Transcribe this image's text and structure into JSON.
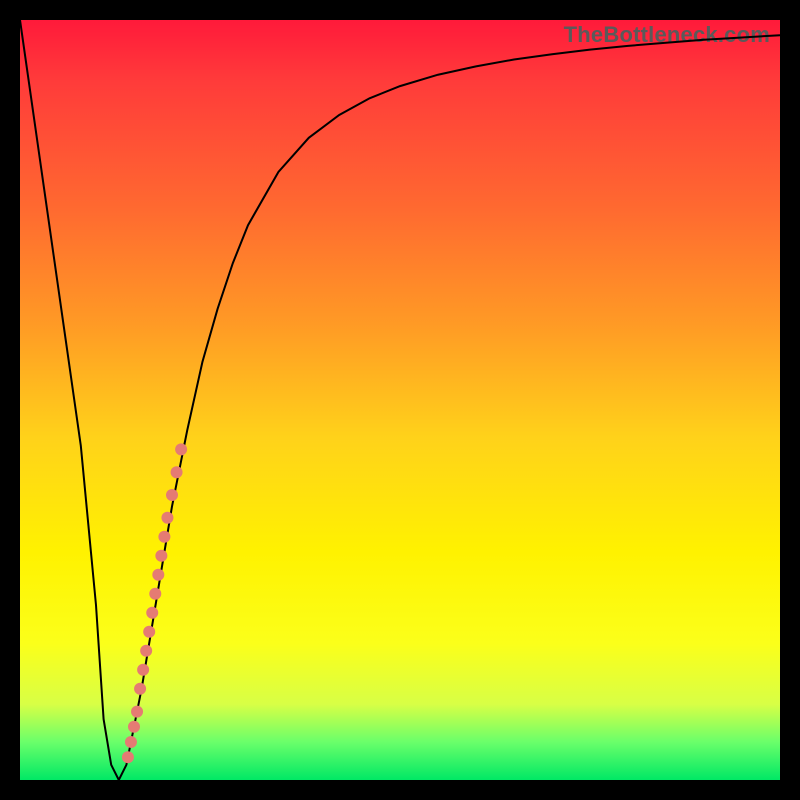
{
  "watermark": "TheBottleneck.com",
  "colors": {
    "curve": "#000000",
    "dot": "#e57b73",
    "frame": "#000000",
    "gradient_top": "#ff1a3a",
    "gradient_bottom": "#00e865"
  },
  "chart_data": {
    "type": "line",
    "title": "",
    "xlabel": "",
    "ylabel": "",
    "xlim": [
      0,
      100
    ],
    "ylim": [
      0,
      100
    ],
    "x": [
      0,
      2,
      4,
      6,
      8,
      10,
      11,
      12,
      13,
      14,
      16,
      18,
      20,
      22,
      24,
      26,
      28,
      30,
      34,
      38,
      42,
      46,
      50,
      55,
      60,
      65,
      70,
      75,
      80,
      85,
      90,
      95,
      100
    ],
    "y": [
      100,
      86,
      72,
      58,
      44,
      23,
      8,
      2,
      0,
      2,
      12,
      24,
      36,
      46,
      55,
      62,
      68,
      73,
      80,
      84.5,
      87.5,
      89.7,
      91.3,
      92.8,
      93.9,
      94.8,
      95.5,
      96.1,
      96.6,
      97.0,
      97.4,
      97.7,
      98.0
    ],
    "highlight_points_x": [
      14.2,
      14.6,
      15.0,
      15.4,
      15.8,
      16.2,
      16.6,
      17.0,
      17.4,
      17.8,
      18.2,
      18.6,
      19.0,
      19.4,
      20.0,
      20.6,
      21.2
    ],
    "highlight_points_y": [
      3.0,
      5.0,
      7.0,
      9.0,
      12.0,
      14.5,
      17.0,
      19.5,
      22.0,
      24.5,
      27.0,
      29.5,
      32.0,
      34.5,
      37.5,
      40.5,
      43.5
    ],
    "dot_radius": 6
  }
}
